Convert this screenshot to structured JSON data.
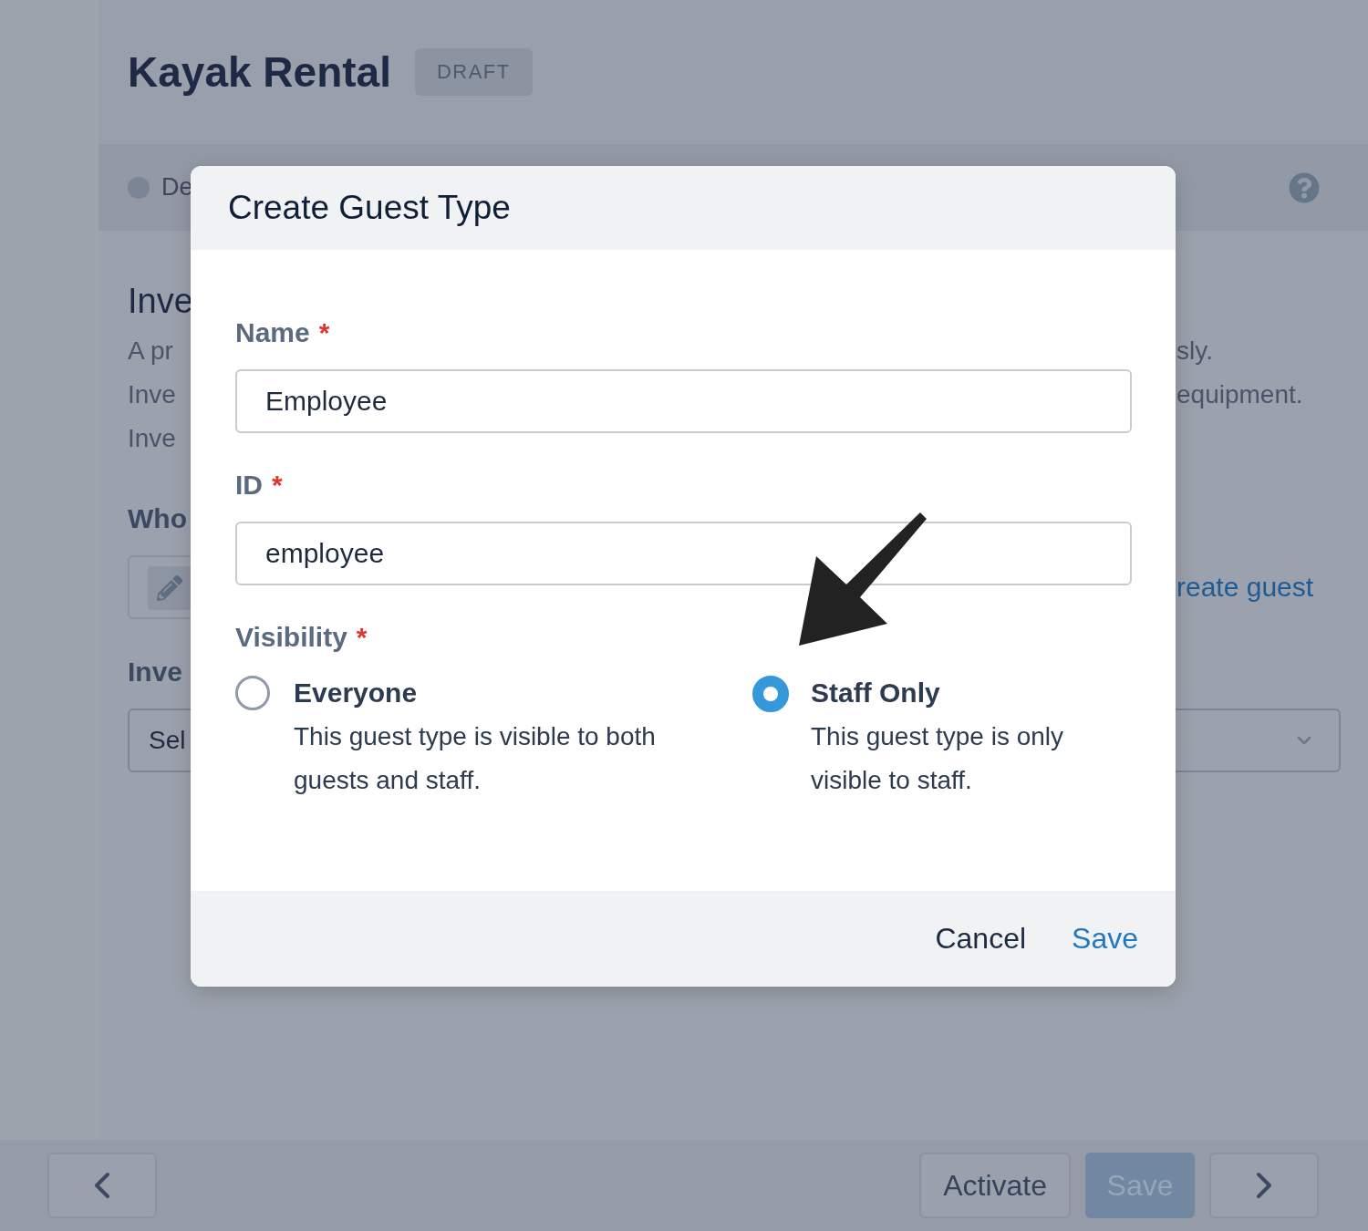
{
  "page": {
    "title": "Kayak Rental",
    "status_badge": "DRAFT"
  },
  "step_bar": {
    "step_label": "De"
  },
  "section": {
    "heading": "Inve",
    "description_lines": [
      {
        "start": "A pr",
        "end": "sly."
      },
      {
        "start": "Inve",
        "end": "equipment."
      },
      {
        "start": "Inve"
      }
    ],
    "who_label": "Who",
    "create_link": "reate guest",
    "inventory_label": "Inve",
    "inventory_select": {
      "value": "Sel"
    }
  },
  "dialog": {
    "title": "Create Guest Type",
    "fields": [
      {
        "label": "Name",
        "required_mark": "*",
        "value": "Employee"
      },
      {
        "label": "ID",
        "required_mark": "*",
        "value": "employee"
      }
    ],
    "visibility": {
      "label": "Visibility",
      "required_mark": "*",
      "options": [
        {
          "title": "Everyone",
          "description": "This guest type is visible to both guests and staff.",
          "selected": false
        },
        {
          "title": "Staff Only",
          "description": "This guest type is only visible to staff.",
          "selected": true
        }
      ]
    },
    "buttons": [
      {
        "kind": "secondary",
        "label": "Cancel"
      },
      {
        "kind": "primary",
        "label": "Save"
      }
    ]
  },
  "bottom_bar": {
    "buttons": [
      {
        "kind": "back"
      },
      {
        "kind": "secondary",
        "label": "Activate",
        "disabled": false
      },
      {
        "kind": "primary",
        "label": "Save",
        "disabled": true
      },
      {
        "kind": "forward"
      }
    ]
  }
}
